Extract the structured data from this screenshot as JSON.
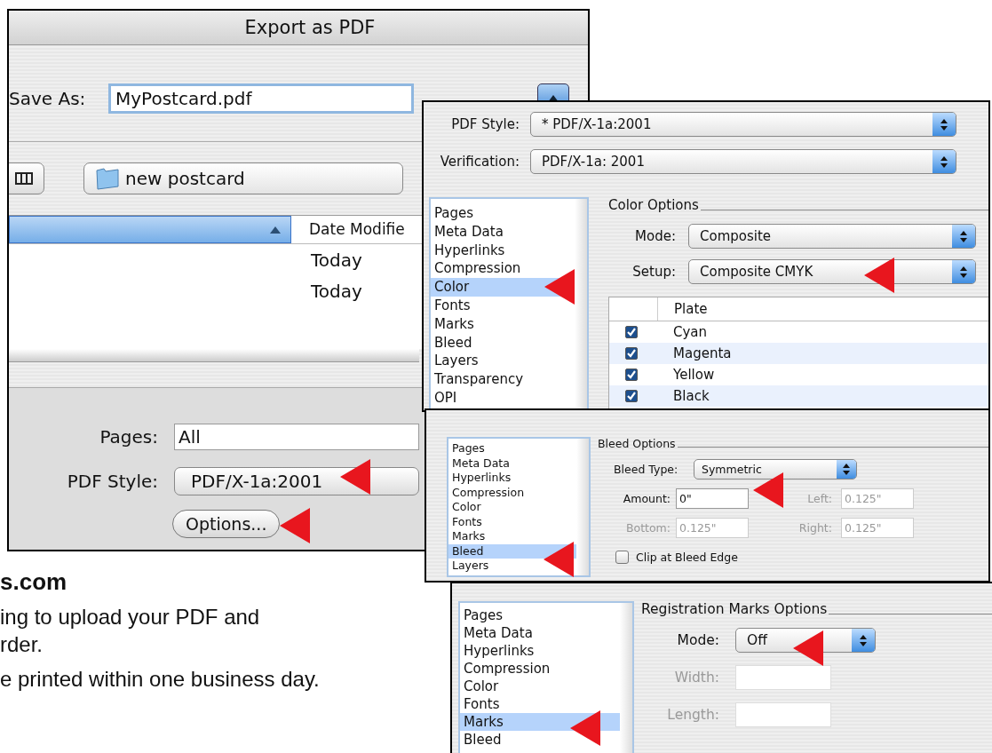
{
  "export_window": {
    "title": "Export as PDF",
    "save_as": {
      "label": "Save As:",
      "value": "MyPostcard.pdf"
    },
    "location": {
      "value": "new postcard"
    },
    "file_list": {
      "date_column": "Date Modifie",
      "rows": [
        {
          "date": "Today"
        },
        {
          "date": "Today"
        }
      ]
    },
    "pages": {
      "label": "Pages:",
      "value": "All"
    },
    "pdf_style": {
      "label": "PDF Style:",
      "value": "PDF/X-1a:2001"
    },
    "options_button": "Options..."
  },
  "color_panel": {
    "pdf_style": {
      "label": "PDF Style:",
      "value": "* PDF/X-1a:2001"
    },
    "verification": {
      "label": "Verification:",
      "value": "PDF/X-1a: 2001"
    },
    "categories": [
      {
        "label": "Pages",
        "selected": false
      },
      {
        "label": "Meta Data",
        "selected": false
      },
      {
        "label": "Hyperlinks",
        "selected": false
      },
      {
        "label": "Compression",
        "selected": false
      },
      {
        "label": "Color",
        "selected": true
      },
      {
        "label": "Fonts",
        "selected": false
      },
      {
        "label": "Marks",
        "selected": false
      },
      {
        "label": "Bleed",
        "selected": false
      },
      {
        "label": "Layers",
        "selected": false
      },
      {
        "label": "Transparency",
        "selected": false
      },
      {
        "label": "OPI",
        "selected": false
      }
    ],
    "section_title": "Color Options",
    "mode": {
      "label": "Mode:",
      "value": "Composite"
    },
    "setup": {
      "label": "Setup:",
      "value": "Composite CMYK"
    },
    "plates": {
      "column": "Plate",
      "rows": [
        {
          "name": "Cyan",
          "checked": true
        },
        {
          "name": "Magenta",
          "checked": true
        },
        {
          "name": "Yellow",
          "checked": true
        },
        {
          "name": "Black",
          "checked": true
        }
      ]
    }
  },
  "bleed_panel": {
    "categories": [
      {
        "label": "Pages",
        "selected": false
      },
      {
        "label": "Meta Data",
        "selected": false
      },
      {
        "label": "Hyperlinks",
        "selected": false
      },
      {
        "label": "Compression",
        "selected": false
      },
      {
        "label": "Color",
        "selected": false
      },
      {
        "label": "Fonts",
        "selected": false
      },
      {
        "label": "Marks",
        "selected": false
      },
      {
        "label": "Bleed",
        "selected": true
      },
      {
        "label": "Layers",
        "selected": false
      }
    ],
    "section_title": "Bleed Options",
    "bleed_type": {
      "label": "Bleed Type:",
      "value": "Symmetric"
    },
    "amount": {
      "label": "Amount:",
      "value": "0\"",
      "disabled": false
    },
    "left": {
      "label": "Left:",
      "value": "0.125\"",
      "disabled": true
    },
    "bottom": {
      "label": "Bottom:",
      "value": "0.125\"",
      "disabled": true
    },
    "right": {
      "label": "Right:",
      "value": "0.125\"",
      "disabled": true
    },
    "clip": {
      "label": "Clip at Bleed Edge",
      "checked": false
    }
  },
  "marks_panel": {
    "categories": [
      {
        "label": "Pages",
        "selected": false
      },
      {
        "label": "Meta Data",
        "selected": false
      },
      {
        "label": "Hyperlinks",
        "selected": false
      },
      {
        "label": "Compression",
        "selected": false
      },
      {
        "label": "Color",
        "selected": false
      },
      {
        "label": "Fonts",
        "selected": false
      },
      {
        "label": "Marks",
        "selected": true
      },
      {
        "label": "Bleed",
        "selected": false
      }
    ],
    "section_title": "Registration Marks Options",
    "mode": {
      "label": "Mode:",
      "value": "Off"
    },
    "width": {
      "label": "Width:",
      "disabled": true
    },
    "length": {
      "label": "Length:",
      "disabled": true
    }
  },
  "page_text": {
    "heading": "s.com",
    "paragraphs": [
      [
        "ing to upload your PDF and",
        "rder."
      ],
      [
        "e printed within one business day."
      ]
    ]
  }
}
